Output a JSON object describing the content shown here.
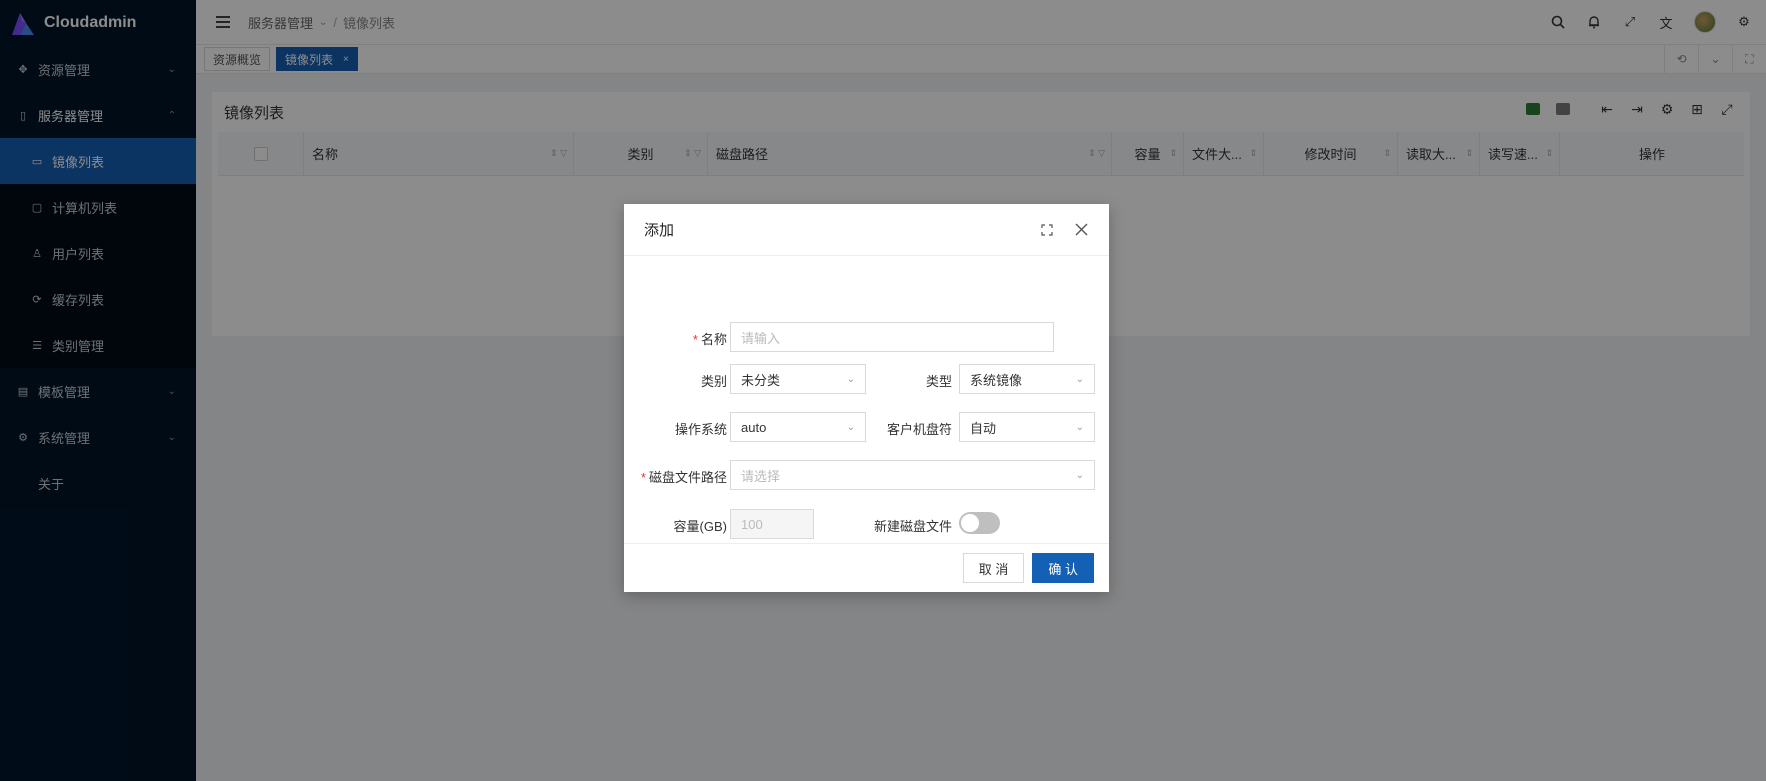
{
  "app": {
    "title": "Cloudadmin"
  },
  "sidebar": {
    "items": [
      {
        "label": "资源管理",
        "icon": "cluster-icon",
        "expanded": false
      },
      {
        "label": "服务器管理",
        "icon": "server-icon",
        "expanded": true,
        "children": [
          {
            "label": "镜像列表",
            "icon": "drive-icon",
            "active": true
          },
          {
            "label": "计算机列表",
            "icon": "monitor-icon"
          },
          {
            "label": "用户列表",
            "icon": "user-icon"
          },
          {
            "label": "缓存列表",
            "icon": "sync-icon"
          },
          {
            "label": "类别管理",
            "icon": "list-icon"
          }
        ]
      },
      {
        "label": "模板管理",
        "icon": "template-icon",
        "expanded": false
      },
      {
        "label": "系统管理",
        "icon": "settings-icon",
        "expanded": false
      },
      {
        "label": "关于"
      }
    ]
  },
  "header": {
    "breadcrumb": [
      "服务器管理",
      "镜像列表"
    ]
  },
  "tabs": [
    {
      "label": "资源概览",
      "active": false
    },
    {
      "label": "镜像列表",
      "active": true,
      "close": "×"
    }
  ],
  "card": {
    "title": "镜像列表",
    "columns": [
      "名称",
      "类别",
      "磁盘路径",
      "容量",
      "文件大...",
      "修改时间",
      "读取大...",
      "读写速...",
      "操作"
    ]
  },
  "modal": {
    "title": "添加",
    "fields": {
      "name": {
        "label": "名称",
        "placeholder": "请输入",
        "required": true
      },
      "category": {
        "label": "类别",
        "value": "未分类"
      },
      "type": {
        "label": "类型",
        "value": "系统镜像"
      },
      "os": {
        "label": "操作系统",
        "value": "auto"
      },
      "drive": {
        "label": "客户机盘符",
        "value": "自动"
      },
      "path": {
        "label": "磁盘文件路径",
        "placeholder": "请选择",
        "required": true
      },
      "capacity": {
        "label": "容量(GB)",
        "placeholder": "100"
      },
      "newdisk": {
        "label": "新建磁盘文件",
        "on": false
      }
    },
    "cancel": "取 消",
    "confirm": "确 认"
  },
  "colors": {
    "primary": "#1460b5",
    "sidebar": "#001529",
    "required": "#e53935"
  }
}
